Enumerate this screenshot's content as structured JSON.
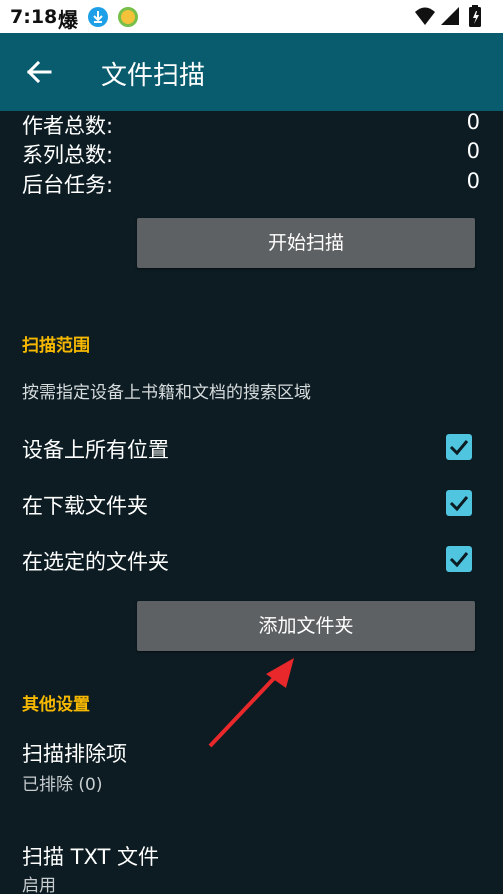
{
  "status": {
    "time": "7:18",
    "explode_glyph": "爆"
  },
  "app_bar": {
    "title": "文件扫描"
  },
  "stats": [
    {
      "label": "作者总数:",
      "value": "0"
    },
    {
      "label": "系列总数:",
      "value": "0"
    },
    {
      "label": "后台任务:",
      "value": "0"
    }
  ],
  "start_scan": {
    "label": "开始扫描"
  },
  "scan_range": {
    "title": "扫描范围",
    "description": "按需指定设备上书籍和文档的搜索区域",
    "options": [
      {
        "label": "设备上所有位置",
        "checked": true
      },
      {
        "label": "在下载文件夹",
        "checked": true
      },
      {
        "label": "在选定的文件夹",
        "checked": true
      }
    ],
    "add_folder_label": "添加文件夹"
  },
  "other_settings": {
    "title": "其他设置",
    "exclusions": {
      "title": "扫描排除项",
      "summary": "已排除 (0)"
    },
    "scan_txt": {
      "title": "扫描 TXT 文件",
      "summary": "启用"
    }
  },
  "colors": {
    "accent": "#f6b800",
    "app_bar": "#085c6e",
    "checkbox": "#4fc5e0",
    "background": "#0c1c22",
    "arrow": "#e8282a"
  }
}
